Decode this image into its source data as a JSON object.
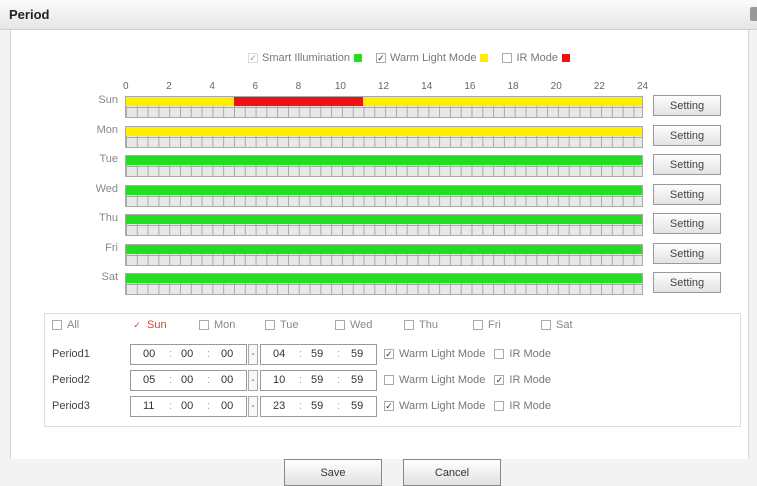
{
  "dialog": {
    "title": "Period"
  },
  "legend": [
    {
      "label": "Smart Illumination",
      "checked": true,
      "color": "#22dd22"
    },
    {
      "label": "Warm Light Mode",
      "checked": true,
      "color": "#ffee00"
    },
    {
      "label": "IR Mode",
      "checked": false,
      "color": "#ee1111"
    }
  ],
  "hours": [
    "0",
    "2",
    "4",
    "6",
    "8",
    "10",
    "12",
    "14",
    "16",
    "18",
    "20",
    "22",
    "24"
  ],
  "days": [
    {
      "label": "Sun",
      "setting": "Setting",
      "segments": [
        {
          "start": 0,
          "end": 5,
          "color": "#ffee00"
        },
        {
          "start": 5,
          "end": 11,
          "color": "#ee1111"
        },
        {
          "start": 11,
          "end": 24,
          "color": "#ffee00"
        }
      ]
    },
    {
      "label": "Mon",
      "setting": "Setting",
      "segments": [
        {
          "start": 0,
          "end": 24,
          "color": "#ffee00"
        }
      ]
    },
    {
      "label": "Tue",
      "setting": "Setting",
      "segments": [
        {
          "start": 0,
          "end": 24,
          "color": "#22dd22"
        }
      ]
    },
    {
      "label": "Wed",
      "setting": "Setting",
      "segments": [
        {
          "start": 0,
          "end": 24,
          "color": "#22dd22"
        }
      ]
    },
    {
      "label": "Thu",
      "setting": "Setting",
      "segments": [
        {
          "start": 0,
          "end": 24,
          "color": "#22dd22"
        }
      ]
    },
    {
      "label": "Fri",
      "setting": "Setting",
      "segments": [
        {
          "start": 0,
          "end": 24,
          "color": "#22dd22"
        }
      ]
    },
    {
      "label": "Sat",
      "setting": "Setting",
      "segments": [
        {
          "start": 0,
          "end": 24,
          "color": "#22dd22"
        }
      ]
    }
  ],
  "day_select": [
    {
      "label": "All",
      "checked": false
    },
    {
      "label": "Sun",
      "checked": true
    },
    {
      "label": "Mon",
      "checked": false
    },
    {
      "label": "Tue",
      "checked": false
    },
    {
      "label": "Wed",
      "checked": false
    },
    {
      "label": "Thu",
      "checked": false
    },
    {
      "label": "Fri",
      "checked": false
    },
    {
      "label": "Sat",
      "checked": false
    }
  ],
  "periods": [
    {
      "label": "Period1",
      "start": [
        "00",
        "00",
        "00"
      ],
      "end": [
        "04",
        "59",
        "59"
      ],
      "warm": true,
      "ir": false,
      "enabled": true
    },
    {
      "label": "Period2",
      "start": [
        "05",
        "00",
        "00"
      ],
      "end": [
        "10",
        "59",
        "59"
      ],
      "warm": false,
      "ir": true,
      "enabled": false
    },
    {
      "label": "Period3",
      "start": [
        "11",
        "00",
        "00"
      ],
      "end": [
        "23",
        "59",
        "59"
      ],
      "warm": true,
      "ir": false,
      "enabled": true
    }
  ],
  "modes": {
    "warm": "Warm Light Mode",
    "ir": "IR Mode",
    "dash": "-"
  },
  "buttons": {
    "save": "Save",
    "cancel": "Cancel"
  }
}
